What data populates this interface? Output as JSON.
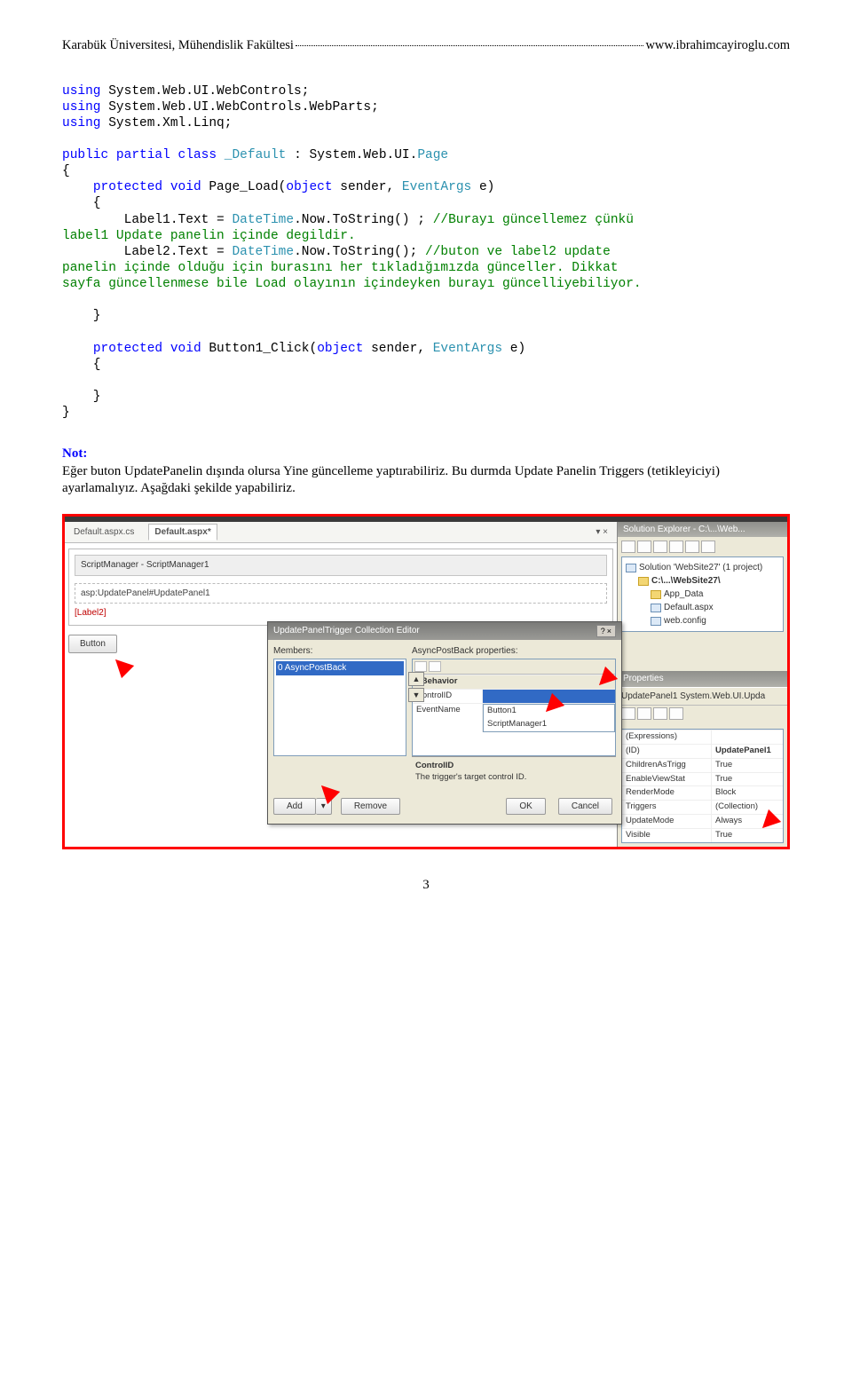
{
  "header": {
    "left": "Karabük Üniversitesi, Mühendislik Fakültesi",
    "right": "www.ibrahimcayiroglu.com"
  },
  "code": {
    "l1a": "using",
    "l1b": "System.Web.UI.WebControls;",
    "l2a": "using",
    "l2b": "System.Web.UI.WebControls.WebParts;",
    "l3a": "using",
    "l3b": "System.Xml.Linq;",
    "l5a": "public",
    "l5b": "partial",
    "l5c": "class",
    "l5d": "_Default",
    "l5e": ":",
    "l5f": "System.Web.UI.",
    "l5g": "Page",
    "l6": "{",
    "l7a": "protected",
    "l7b": "void",
    "l7c": "Page_Load(",
    "l7d": "object",
    "l7e": "sender,",
    "l7f": "EventArgs",
    "l7g": "e)",
    "l8": "    {",
    "l9a": "        Label1.Text =",
    "l9b": "DateTime",
    "l9c": ".Now.ToString() ;",
    "l9d": "//Burayı güncellemez çünkü",
    "l10": "label1 Update panelin içinde degildir.",
    "l11a": "        Label2.Text =",
    "l11b": "DateTime",
    "l11c": ".Now.ToString();",
    "l11d": "//buton ve label2 update",
    "l12": "panelin içinde olduğu için burasını her tıkladığımızda günceller. Dikkat",
    "l13": "sayfa güncellenmese bile Load olayının içindeyken burayı güncelliyebiliyor.",
    "l15": "    }",
    "l17a": "protected",
    "l17b": "void",
    "l17c": "Button1_Click(",
    "l17d": "object",
    "l17e": "sender,",
    "l17f": "EventArgs",
    "l17g": "e)",
    "l18": "    {",
    "l20": "    }",
    "l21": "}"
  },
  "note": {
    "label": "Not:",
    "text": "Eğer buton UpdatePanelin dışında olursa Yine güncelleme yaptırabiliriz. Bu durmda Update Panelin Triggers (tetikleyiciyi) ayarlamalıyız. Aşağdaki şekilde yapabiliriz."
  },
  "ss": {
    "tabs": {
      "inactive": "Default.aspx.cs",
      "active": "Default.aspx*"
    },
    "scriptManager": "ScriptManager - ScriptManager1",
    "updatePanel": "asp:UpdatePanel#UpdatePanel1",
    "label2": "[Label2]",
    "button": "Button",
    "dialog": {
      "title": "UpdatePanelTrigger Collection Editor",
      "membersLbl": "Members:",
      "member0": "0  AsyncPostBack",
      "rightLbl": "AsyncPostBack properties:",
      "behavior": "Behavior",
      "controlId_k": "ControlID",
      "controlId_v": "",
      "eventName_k": "EventName",
      "opt1": "Button1",
      "opt2": "ScriptManager1",
      "help_t": "ControlID",
      "help_d": "The trigger's target control ID.",
      "add": "Add",
      "remove": "Remove",
      "ok": "OK",
      "cancel": "Cancel"
    },
    "solExp": {
      "title": "Solution Explorer - C:\\...\\Web...",
      "node0": "Solution 'WebSite27' (1 project)",
      "node1": "C:\\...\\WebSite27\\",
      "node2a": "App_Data",
      "node2b": "Default.aspx",
      "node2c": "web.config"
    },
    "props": {
      "title": "Properties",
      "sel": "UpdatePanel1 System.Web.UI.Upda",
      "expressions": "(Expressions)",
      "id_k": "(ID)",
      "id_v": "UpdatePanel1",
      "cat_k": "ChildrenAsTrigg",
      "cat_v": "True",
      "evs_k": "EnableViewStat",
      "evs_v": "True",
      "rm_k": "RenderMode",
      "rm_v": "Block",
      "trg_k": "Triggers",
      "trg_v": "(Collection)",
      "um_k": "UpdateMode",
      "um_v": "Always",
      "vis_k": "Visible",
      "vis_v": "True"
    }
  },
  "pagenum": "3"
}
